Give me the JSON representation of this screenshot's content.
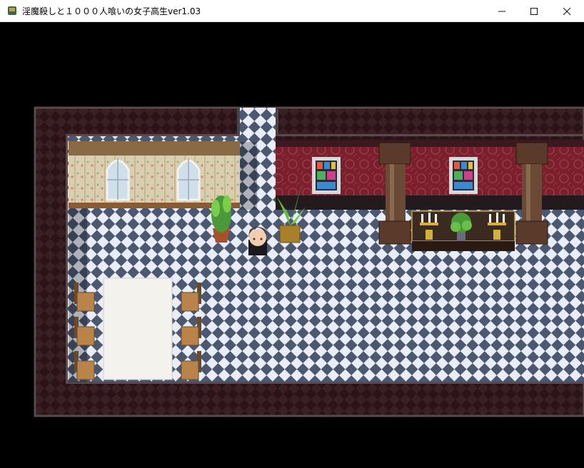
{
  "window": {
    "title": "淫魔殺しと１０００人喰いの女子高生ver1.03",
    "icon": "rpg-maker-app-icon",
    "controls": [
      "minimize-icon",
      "maximize-icon",
      "close-icon"
    ]
  },
  "scene": {
    "type": "top-down RPG map",
    "location": "manor hall with dining room and chapel-like corridor",
    "player": "dark-haired boy in black uniform",
    "colors": {
      "void": "#000000",
      "outer_wall": "#3a1f24",
      "tile_light": "#e9edf7",
      "tile_dark": "#4c5870",
      "red_wallpaper": "#7a1f2c",
      "cream_wallpaper": "#d9cfb0",
      "wood": "#8a5a33"
    }
  }
}
